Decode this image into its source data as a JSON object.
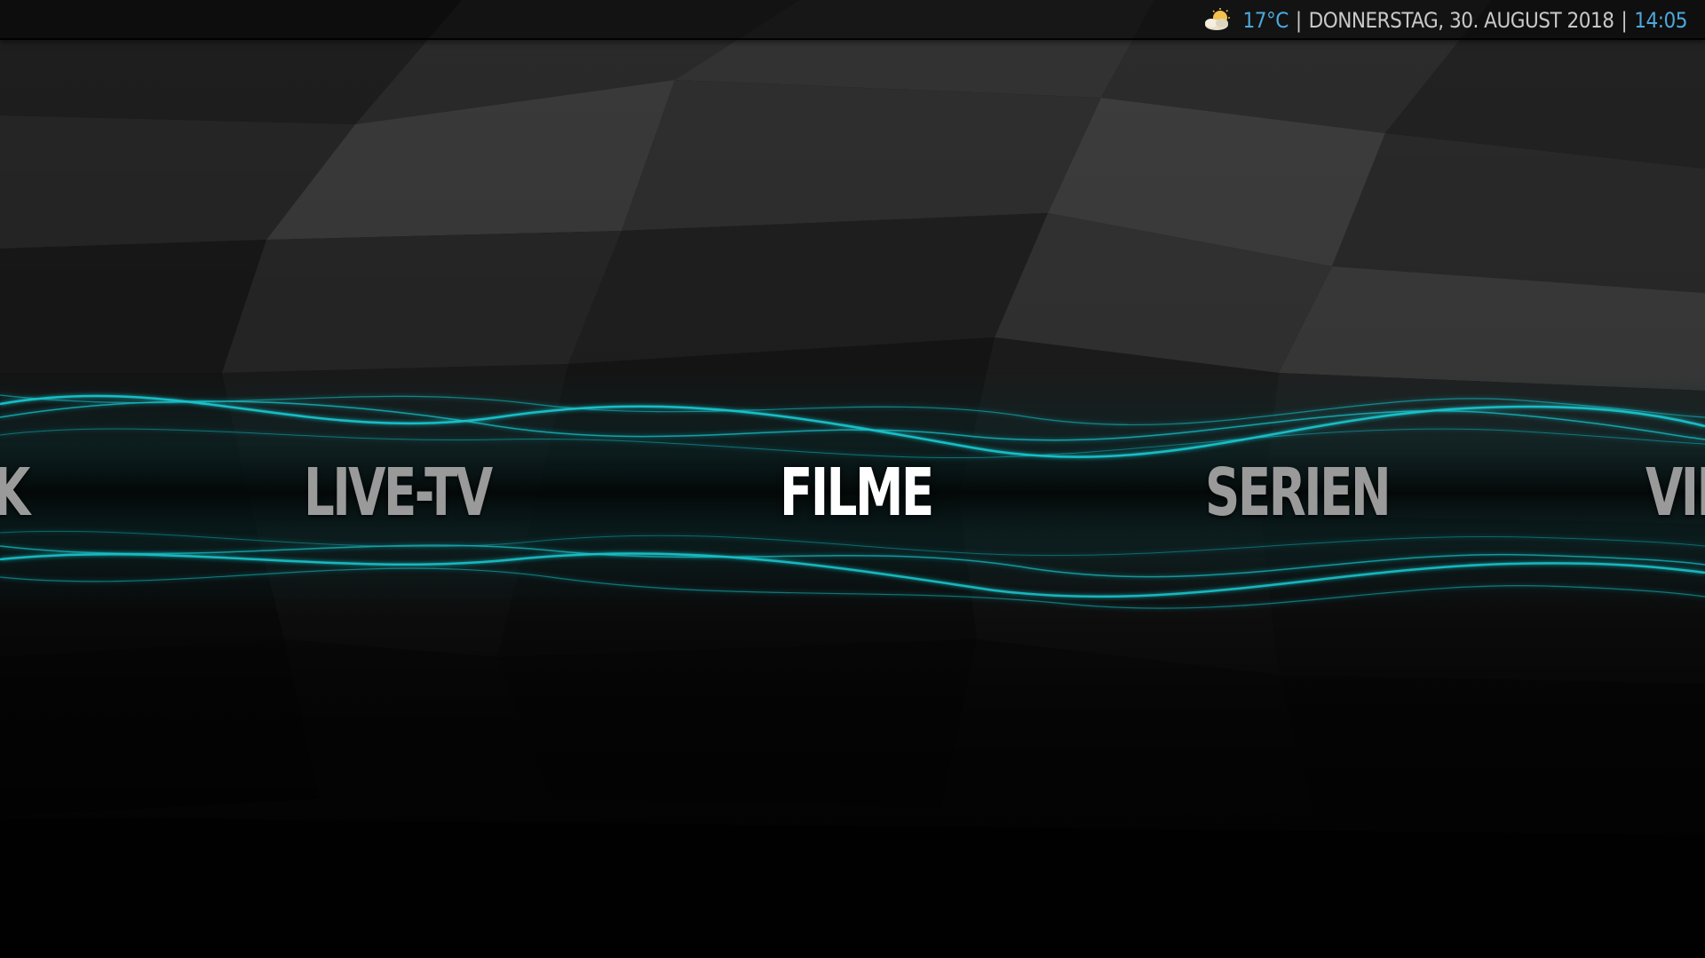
{
  "status_bar": {
    "weather_icon": "partly-cloudy-sun-icon",
    "temperature": "17°C",
    "separator": "|",
    "date": "DONNERSTAG, 30. AUGUST 2018",
    "time": "14:05"
  },
  "main_menu": {
    "items": [
      {
        "label": "K"
      },
      {
        "label": "LIVE-TV"
      },
      {
        "label": "FILME"
      },
      {
        "label": "SERIEN"
      },
      {
        "label": "VID"
      }
    ],
    "selected_label": "FILME"
  },
  "colors": {
    "accent": "#4da8dc",
    "wave": "#19c9d0",
    "text_inactive": "#9a9a9a",
    "text_active": "#ffffff"
  }
}
